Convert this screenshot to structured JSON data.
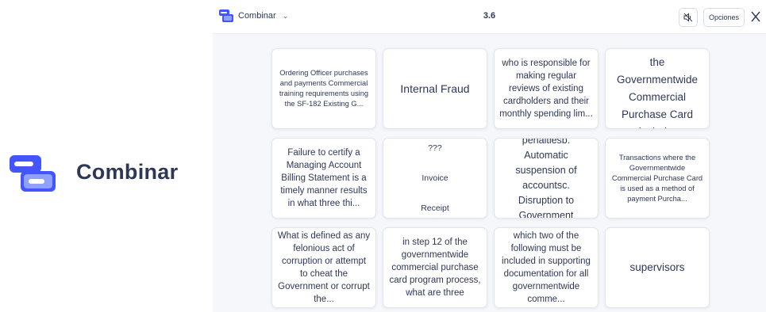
{
  "brand": {
    "title": "Combinar"
  },
  "topbar": {
    "mode_label": "Combinar",
    "mode_chevron": "⌄",
    "timer": "3.6",
    "sound_icon": "sound-off-icon",
    "options_label": "Opciones",
    "close_icon": "close-icon"
  },
  "colors": {
    "logo_dark": "#3ccfcf",
    "logo_light": "#4255ff",
    "logo_blue": "#4255ff"
  },
  "cards": [
    {
      "text": "Ordering Officer purchases and payments Commercial training requirements using the SF-182 Existing G..."
    },
    {
      "text": "Internal Fraud"
    },
    {
      "text": "who is responsible for making regular reviews of existing cardholders and their monthly spending lim..."
    },
    {
      "text": "Authorized uses of the Governmentwide Commercial Purchase Card include:"
    },
    {
      "text": "Failure to certify a Managing Account Billing Statement is a timely manner results in what three thi..."
    },
    {
      "lines": [
        "???",
        "Invoice",
        "Receipt"
      ]
    },
    {
      "text": "a. Interest penaltiesb. Automatic suspension of accountsc. Disruption to Government purchases"
    },
    {
      "text": "Transactions where the Governmentwide Commercial Purchase Card is used as a method of payment Purcha..."
    },
    {
      "text": "What is defined as any felonious act of corruption or attempt to cheat the Government or corrupt the..."
    },
    {
      "text": "in step 12 of the governmentwide commercial purchase card program process, what are three"
    },
    {
      "text": "which two of the following must be included in supporting documentation for all governmentwide comme..."
    },
    {
      "text": "supervisors"
    }
  ]
}
